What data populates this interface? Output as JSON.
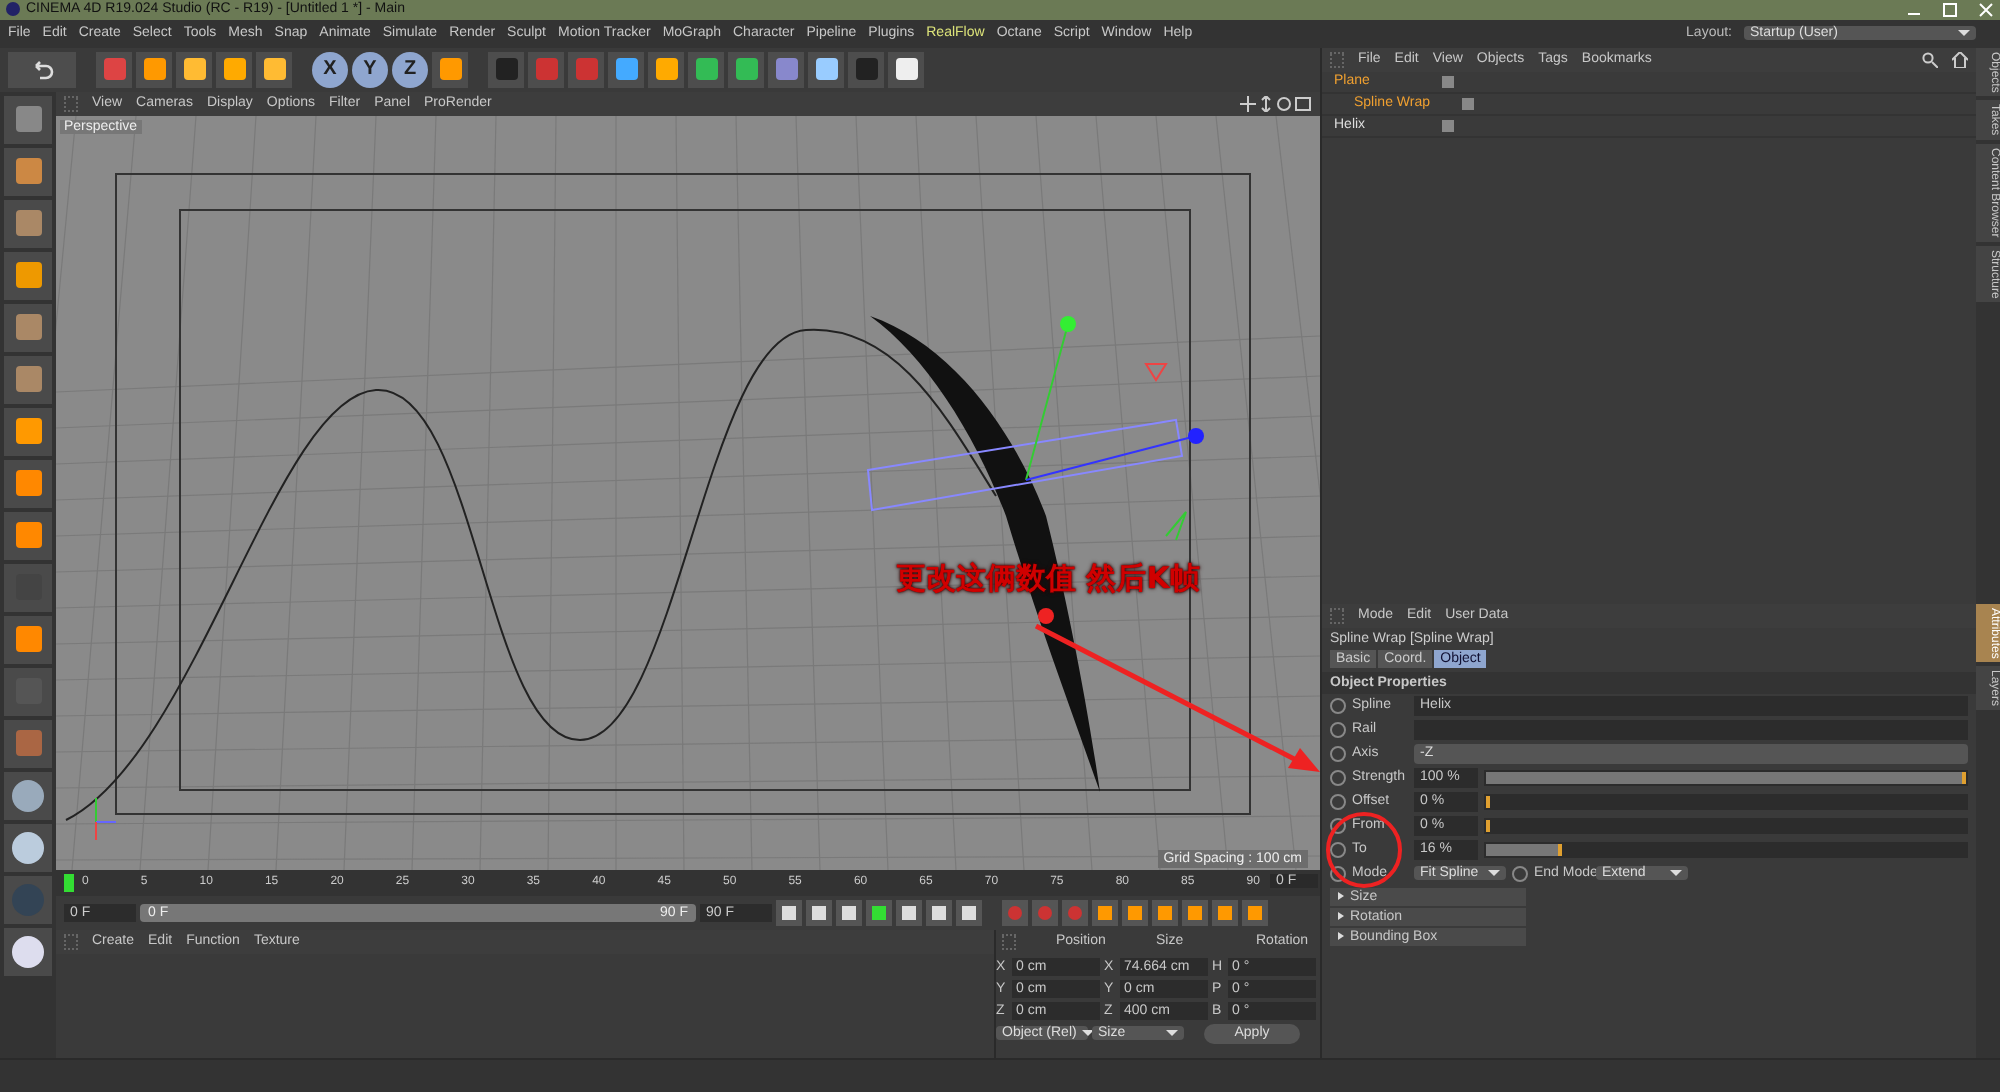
{
  "window": {
    "title": "CINEMA 4D R19.024 Studio (RC - R19) - [Untitled 1 *] - Main"
  },
  "menu": [
    {
      "label": "File",
      "highlighted": false
    },
    {
      "label": "Edit",
      "highlighted": false
    },
    {
      "label": "Create",
      "highlighted": false
    },
    {
      "label": "Select",
      "highlighted": false
    },
    {
      "label": "Tools",
      "highlighted": false
    },
    {
      "label": "Mesh",
      "highlighted": false
    },
    {
      "label": "Snap",
      "highlighted": false
    },
    {
      "label": "Animate",
      "highlighted": false
    },
    {
      "label": "Simulate",
      "highlighted": false
    },
    {
      "label": "Render",
      "highlighted": false
    },
    {
      "label": "Sculpt",
      "highlighted": false
    },
    {
      "label": "Motion Tracker",
      "highlighted": false
    },
    {
      "label": "MoGraph",
      "highlighted": false
    },
    {
      "label": "Character",
      "highlighted": false
    },
    {
      "label": "Pipeline",
      "highlighted": false
    },
    {
      "label": "Plugins",
      "highlighted": false
    },
    {
      "label": "RealFlow",
      "highlighted": true
    },
    {
      "label": "Octane",
      "highlighted": false
    },
    {
      "label": "Script",
      "highlighted": false
    },
    {
      "label": "Window",
      "highlighted": false
    },
    {
      "label": "Help",
      "highlighted": false
    }
  ],
  "layout": {
    "label": "Layout:",
    "value": "Startup (User)"
  },
  "axis_buttons": [
    {
      "label": "X",
      "on": true
    },
    {
      "label": "Y",
      "on": true
    },
    {
      "label": "Z",
      "on": true
    }
  ],
  "viewport": {
    "menu": [
      "View",
      "Cameras",
      "Display",
      "Options",
      "Filter",
      "Panel",
      "ProRender"
    ],
    "label": "Perspective",
    "grid_spacing": "Grid Spacing : 100 cm",
    "annotation": "更改这俩数值 然后K帧"
  },
  "object_manager": {
    "menu": [
      "File",
      "Edit",
      "View",
      "Objects",
      "Tags",
      "Bookmarks"
    ],
    "objects": [
      {
        "name": "Plane",
        "selected": true,
        "children": [
          {
            "name": "Spline Wrap",
            "selected": true
          }
        ]
      },
      {
        "name": "Helix",
        "selected": false
      }
    ]
  },
  "side_tabs_top": [
    "Objects",
    "Takes",
    "Content Browser",
    "Structure"
  ],
  "side_tabs_bottom": [
    {
      "label": "Attributes",
      "selected": true
    },
    {
      "label": "Layers",
      "selected": false
    }
  ],
  "attributes": {
    "menu": [
      "Mode",
      "Edit",
      "User Data"
    ],
    "object_title": "Spline Wrap [Spline Wrap]",
    "tabs": [
      {
        "label": "Basic",
        "selected": false
      },
      {
        "label": "Coord.",
        "selected": false
      },
      {
        "label": "Object",
        "selected": true
      }
    ],
    "section": "Object Properties",
    "params": [
      {
        "kind": "link",
        "label": "Spline",
        "value": "Helix"
      },
      {
        "kind": "link",
        "label": "Rail"
      },
      {
        "kind": "dropdown",
        "label": "Axis",
        "value": "-Z"
      },
      {
        "kind": "slider",
        "label": "Strength",
        "value": "100 %",
        "level": 1
      },
      {
        "kind": "slider",
        "label": "Offset",
        "value": "0 %",
        "level": 0
      },
      {
        "kind": "slider",
        "label": "From",
        "value": "0 %",
        "level": 0
      },
      {
        "kind": "slider",
        "label": "To",
        "value": "16 %",
        "level": 0.16
      }
    ],
    "mode_row": {
      "mode_label": "Mode",
      "mode_value": "Fit Spline",
      "end_label": "End Mode",
      "end_value": "Extend"
    },
    "groups": [
      "Size",
      "Rotation",
      "Bounding Box"
    ]
  },
  "timeline": {
    "ticks": [
      "0",
      "5",
      "10",
      "15",
      "20",
      "25",
      "30",
      "35",
      "40",
      "45",
      "50",
      "55",
      "60",
      "65",
      "70",
      "75",
      "80",
      "85",
      "90"
    ],
    "current_frame": "0 F",
    "start": "0 F",
    "range_start": "0 F",
    "range_end": "90 F",
    "end": "90 F"
  },
  "materials": {
    "menu": [
      "Create",
      "Edit",
      "Function",
      "Texture"
    ]
  },
  "coordinates": {
    "headers": [
      "Position",
      "Size",
      "Rotation"
    ],
    "rows": [
      {
        "axis": "X",
        "pos": "0 cm",
        "size_axis": "X",
        "size": "74.664 cm",
        "rot_axis": "H",
        "rot": "0 °"
      },
      {
        "axis": "Y",
        "pos": "0 cm",
        "size_axis": "Y",
        "size": "0 cm",
        "rot_axis": "P",
        "rot": "0 °"
      },
      {
        "axis": "Z",
        "pos": "0 cm",
        "size_axis": "Z",
        "size": "400 cm",
        "rot_axis": "B",
        "rot": "0 °"
      }
    ],
    "mode": "Object (Rel)",
    "size_mode": "Size",
    "apply": "Apply"
  }
}
